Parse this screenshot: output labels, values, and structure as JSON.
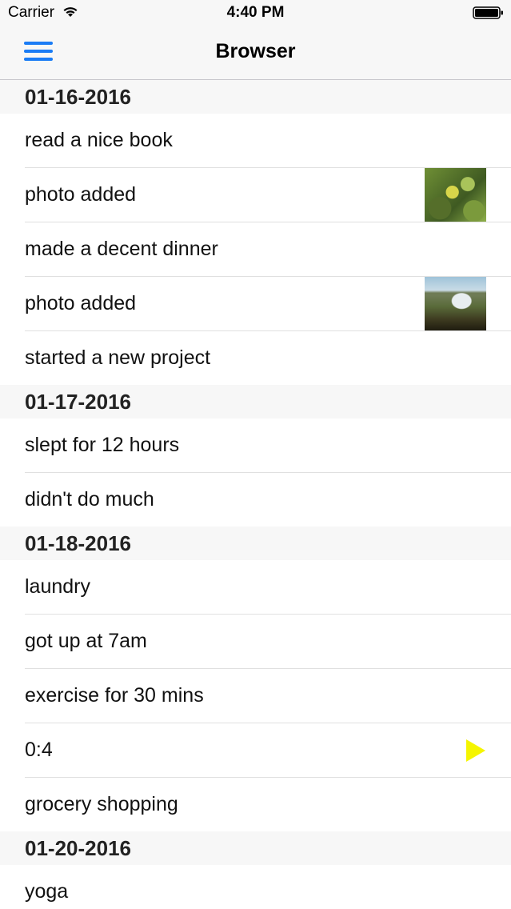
{
  "status_bar": {
    "carrier": "Carrier",
    "time": "4:40 PM",
    "icons": [
      "wifi-icon",
      "battery-icon"
    ]
  },
  "nav": {
    "title": "Browser",
    "menu_icon": "hamburger-menu-icon",
    "accent_color": "#1a7cf5"
  },
  "sections": [
    {
      "date": "01-16-2016",
      "items": [
        {
          "label": "read a nice book"
        },
        {
          "label": "photo added",
          "thumbnail": "lemon-tree-photo"
        },
        {
          "label": "made a decent dinner"
        },
        {
          "label": "photo added",
          "thumbnail": "waterfall-photo"
        },
        {
          "label": "started a new project"
        }
      ]
    },
    {
      "date": "01-17-2016",
      "items": [
        {
          "label": "slept for 12 hours"
        },
        {
          "label": "didn't do much"
        }
      ]
    },
    {
      "date": "01-18-2016",
      "items": [
        {
          "label": "laundry"
        },
        {
          "label": "got up at 7am"
        },
        {
          "label": "exercise for 30 mins"
        },
        {
          "label": "0:4",
          "icon": "play-icon",
          "icon_color": "#f5f500"
        },
        {
          "label": "grocery shopping"
        }
      ]
    },
    {
      "date": "01-20-2016",
      "items": [
        {
          "label": "yoga"
        }
      ]
    }
  ]
}
